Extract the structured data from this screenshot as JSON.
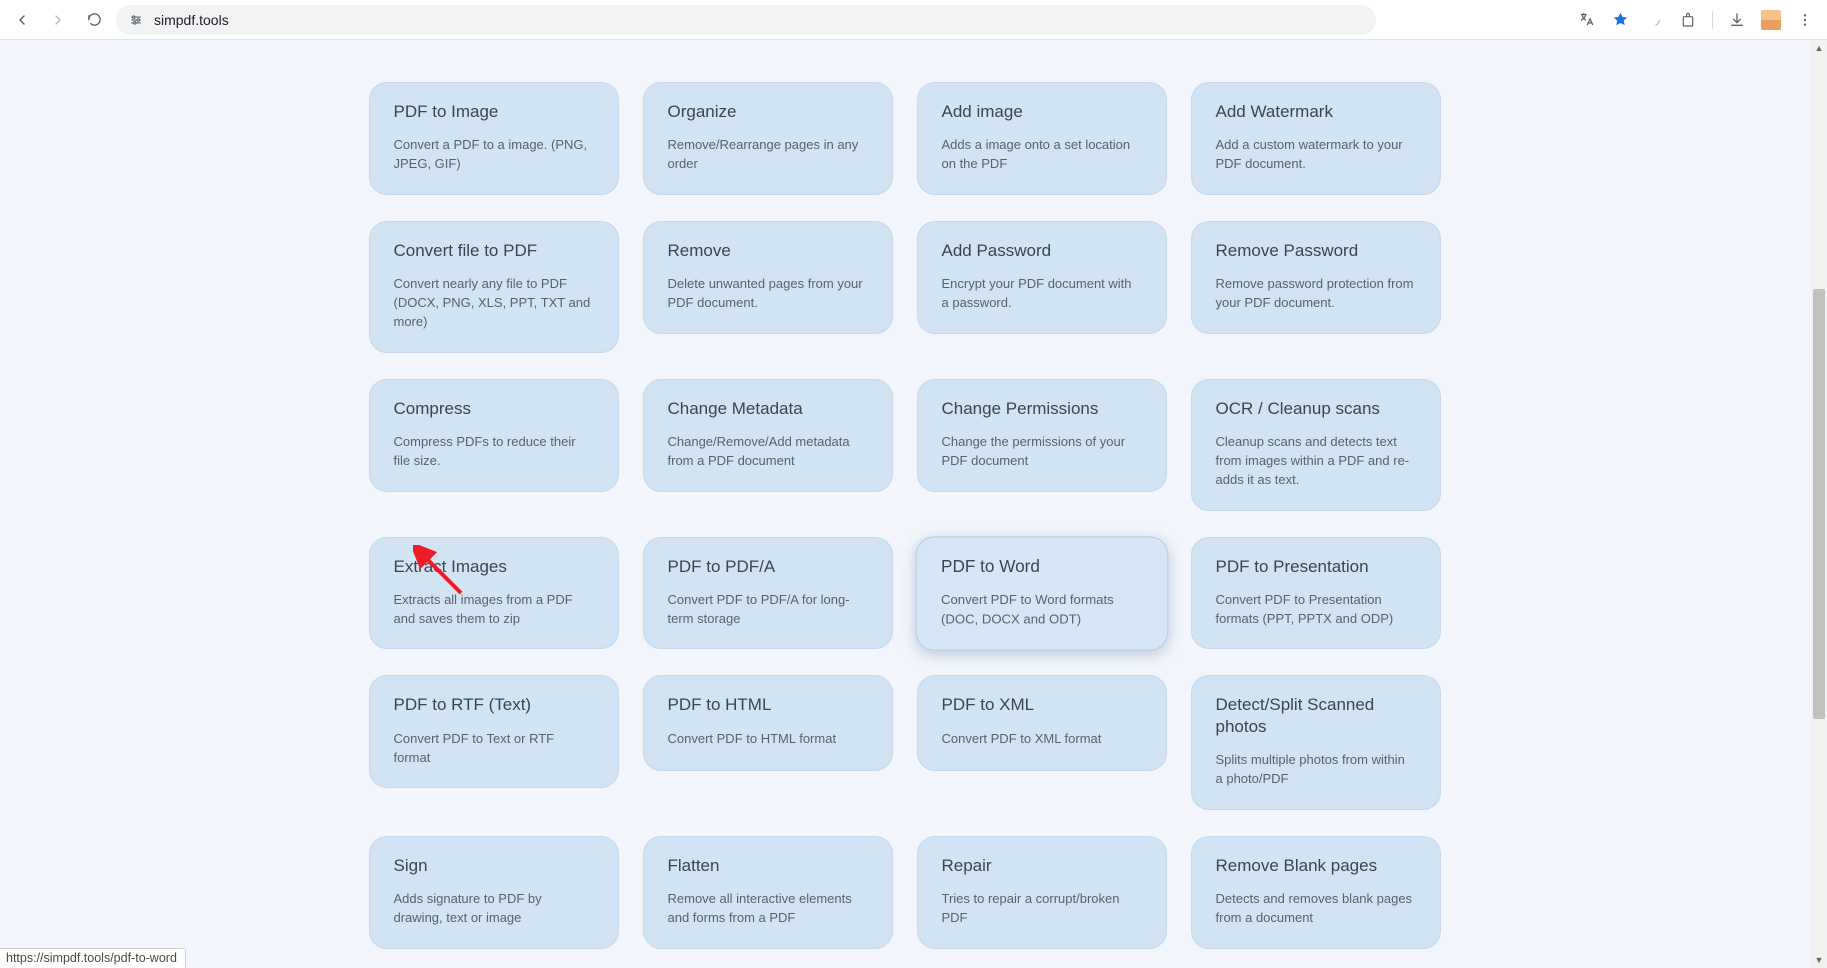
{
  "browser": {
    "url_display": "simpdf.tools",
    "status_url": "https://simpdf.tools/pdf-to-word"
  },
  "cards": [
    {
      "title": "PDF to Image",
      "desc": "Convert a PDF to a image. (PNG, JPEG, GIF)"
    },
    {
      "title": "Organize",
      "desc": "Remove/Rearrange pages in any order"
    },
    {
      "title": "Add image",
      "desc": "Adds a image onto a set location on the PDF"
    },
    {
      "title": "Add Watermark",
      "desc": "Add a custom watermark to your PDF document."
    },
    {
      "title": "Convert file to PDF",
      "desc": "Convert nearly any file to PDF (DOCX, PNG, XLS, PPT, TXT and more)"
    },
    {
      "title": "Remove",
      "desc": "Delete unwanted pages from your PDF document."
    },
    {
      "title": "Add Password",
      "desc": "Encrypt your PDF document with a password."
    },
    {
      "title": "Remove Password",
      "desc": "Remove password protection from your PDF document."
    },
    {
      "title": "Compress",
      "desc": "Compress PDFs to reduce their file size."
    },
    {
      "title": "Change Metadata",
      "desc": "Change/Remove/Add metadata from a PDF document"
    },
    {
      "title": "Change Permissions",
      "desc": "Change the permissions of your PDF document"
    },
    {
      "title": "OCR / Cleanup scans",
      "desc": "Cleanup scans and detects text from images within a PDF and re-adds it as text."
    },
    {
      "title": "Extract Images",
      "desc": "Extracts all images from a PDF and saves them to zip"
    },
    {
      "title": "PDF to PDF/A",
      "desc": "Convert PDF to PDF/A for long-term storage"
    },
    {
      "title": "PDF to Word",
      "desc": "Convert PDF to Word formats (DOC, DOCX and ODT)"
    },
    {
      "title": "PDF to Presentation",
      "desc": "Convert PDF to Presentation formats (PPT, PPTX and ODP)"
    },
    {
      "title": "PDF to RTF (Text)",
      "desc": "Convert PDF to Text or RTF format"
    },
    {
      "title": "PDF to HTML",
      "desc": "Convert PDF to HTML format"
    },
    {
      "title": "PDF to XML",
      "desc": "Convert PDF to XML format"
    },
    {
      "title": "Detect/Split Scanned photos",
      "desc": "Splits multiple photos from within a photo/PDF"
    },
    {
      "title": "Sign",
      "desc": "Adds signature to PDF by drawing, text or image"
    },
    {
      "title": "Flatten",
      "desc": "Remove all interactive elements and forms from a PDF"
    },
    {
      "title": "Repair",
      "desc": "Tries to repair a corrupt/broken PDF"
    },
    {
      "title": "Remove Blank pages",
      "desc": "Detects and removes blank pages from a document"
    }
  ],
  "hover_index": 14
}
